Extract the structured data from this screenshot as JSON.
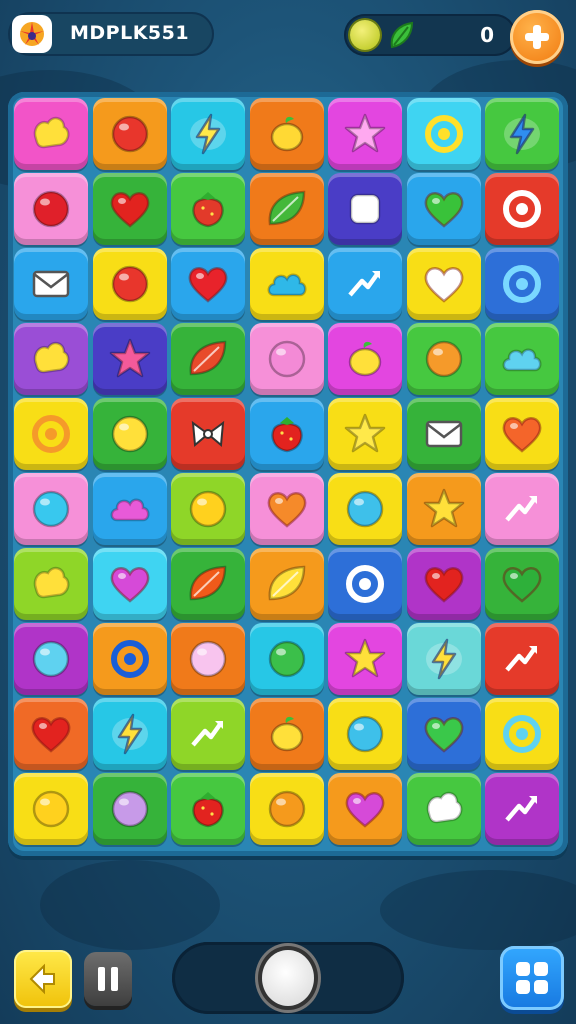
{
  "app": {
    "title": "MDPLK551"
  },
  "topbar": {
    "score": "0",
    "coin_icon": "coin-icon",
    "leaf_icon": "leaf-icon",
    "add_icon": "plus-icon"
  },
  "colors": {
    "pink": "#f254c8",
    "orange": "#f59a1c",
    "cyan": "#27c7e6",
    "darkorange": "#f07a1a",
    "magenta": "#e346e0",
    "sky": "#3fd4f2",
    "green": "#46c840",
    "lightpink": "#f690d8",
    "darkgreen": "#36b33a",
    "blue": "#2aa6ec",
    "navy": "#4a3dc6",
    "red": "#e53a2a",
    "yellow": "#f8de16",
    "purple": "#9a4ed6",
    "darkblue": "#2d6fd8",
    "orangered": "#f06a26",
    "lime": "#8fd628",
    "teal": "#3ed6d2",
    "violet": "#b034c8",
    "mint": "#6ad8d8"
  },
  "board": {
    "rows": [
      [
        {
          "c": "pink",
          "i": "blob",
          "f": "#ffe03a"
        },
        {
          "c": "orange",
          "i": "circle",
          "f": "#e8362c"
        },
        {
          "c": "cyan",
          "i": "bolt",
          "f": "#ffe94a"
        },
        {
          "c": "darkorange",
          "i": "lemon",
          "f": "#ffd934"
        },
        {
          "c": "magenta",
          "i": "star",
          "f": "#ffa9f0"
        },
        {
          "c": "sky",
          "i": "ring",
          "f": "#ffe02a"
        },
        {
          "c": "green",
          "i": "bolt",
          "f": "#2f8ef0"
        }
      ],
      [
        {
          "c": "lightpink",
          "i": "circle",
          "f": "#e0202a"
        },
        {
          "c": "darkgreen",
          "i": "heart",
          "f": "#e2231f"
        },
        {
          "c": "green",
          "i": "berry",
          "f": "#e23a2a"
        },
        {
          "c": "darkorange",
          "i": "leaf",
          "f": "#43b83a"
        },
        {
          "c": "navy",
          "i": "square",
          "f": "#ffffff"
        },
        {
          "c": "blue",
          "i": "heart",
          "f": "#39c23a"
        },
        {
          "c": "red",
          "i": "ring",
          "f": "#ffffff"
        }
      ],
      [
        {
          "c": "blue",
          "i": "envelope",
          "f": "#ffffff"
        },
        {
          "c": "yellow",
          "i": "circle",
          "f": "#e8362c"
        },
        {
          "c": "blue",
          "i": "heart",
          "f": "#e8232b"
        },
        {
          "c": "yellow",
          "i": "cloud",
          "f": "#2fb8e8"
        },
        {
          "c": "blue",
          "i": "arrow",
          "f": "#ffffff"
        },
        {
          "c": "yellow",
          "i": "heart",
          "f": "#ffffff"
        },
        {
          "c": "darkblue",
          "i": "ring",
          "f": "#7ad8ff"
        }
      ],
      [
        {
          "c": "purple",
          "i": "blob",
          "f": "#ffe03a"
        },
        {
          "c": "navy",
          "i": "star",
          "f": "#f45a9a"
        },
        {
          "c": "darkgreen",
          "i": "leaf",
          "f": "#e84a2a"
        },
        {
          "c": "lightpink",
          "i": "circle",
          "f": "#f38ad6"
        },
        {
          "c": "magenta",
          "i": "lemon",
          "f": "#ffe03a"
        },
        {
          "c": "green",
          "i": "circle",
          "f": "#f59a2a"
        },
        {
          "c": "green",
          "i": "cloud",
          "f": "#5fd2f0"
        }
      ],
      [
        {
          "c": "yellow",
          "i": "ring",
          "f": "#f59a2a"
        },
        {
          "c": "darkgreen",
          "i": "circle",
          "f": "#ffe03a"
        },
        {
          "c": "red",
          "i": "bow",
          "f": "#ffffff"
        },
        {
          "c": "blue",
          "i": "berry",
          "f": "#e2231f"
        },
        {
          "c": "yellow",
          "i": "star",
          "f": "#ffe94a"
        },
        {
          "c": "darkgreen",
          "i": "envelope",
          "f": "#ffffff"
        },
        {
          "c": "yellow",
          "i": "heart",
          "f": "#f4652a"
        }
      ],
      [
        {
          "c": "lightpink",
          "i": "circle",
          "f": "#38c8ee"
        },
        {
          "c": "blue",
          "i": "cloud",
          "f": "#e85ad8"
        },
        {
          "c": "lime",
          "i": "circle",
          "f": "#ffd11e"
        },
        {
          "c": "lightpink",
          "i": "heart",
          "f": "#f58a2a"
        },
        {
          "c": "yellow",
          "i": "circle",
          "f": "#3ec0ea"
        },
        {
          "c": "orange",
          "i": "star",
          "f": "#ffe03a"
        },
        {
          "c": "lightpink",
          "i": "arrow",
          "f": "#ffffff"
        }
      ],
      [
        {
          "c": "lime",
          "i": "blob",
          "f": "#ffe03a"
        },
        {
          "c": "sky",
          "i": "heart",
          "f": "#d64ad8"
        },
        {
          "c": "darkgreen",
          "i": "leaf",
          "f": "#f05a1a"
        },
        {
          "c": "orange",
          "i": "leaf",
          "f": "#ffe03a"
        },
        {
          "c": "darkblue",
          "i": "ring",
          "f": "#ffffff"
        },
        {
          "c": "violet",
          "i": "heart",
          "f": "#e2231f"
        },
        {
          "c": "darkgreen",
          "i": "heart",
          "f": "#2eb03a"
        }
      ],
      [
        {
          "c": "violet",
          "i": "circle",
          "f": "#5fd2f0"
        },
        {
          "c": "orange",
          "i": "ring",
          "f": "#1a5ed8"
        },
        {
          "c": "darkorange",
          "i": "circle",
          "f": "#f8c4ee"
        },
        {
          "c": "cyan",
          "i": "circle",
          "f": "#3bbf4a"
        },
        {
          "c": "magenta",
          "i": "star",
          "f": "#ffe03a"
        },
        {
          "c": "mint",
          "i": "bolt",
          "f": "#ffe03a"
        },
        {
          "c": "red",
          "i": "arrow",
          "f": "#ffffff"
        }
      ],
      [
        {
          "c": "orangered",
          "i": "heart",
          "f": "#e2231f"
        },
        {
          "c": "cyan",
          "i": "bolt",
          "f": "#ffe03a"
        },
        {
          "c": "lime",
          "i": "arrow",
          "f": "#ffffff"
        },
        {
          "c": "darkorange",
          "i": "lemon",
          "f": "#ffe03a"
        },
        {
          "c": "yellow",
          "i": "circle",
          "f": "#3ec0ea"
        },
        {
          "c": "darkblue",
          "i": "heart",
          "f": "#3ac84a"
        },
        {
          "c": "yellow",
          "i": "ring",
          "f": "#5fd2f0"
        }
      ],
      [
        {
          "c": "yellow",
          "i": "circle",
          "f": "#ffd11e"
        },
        {
          "c": "darkgreen",
          "i": "circle",
          "f": "#c79ae8"
        },
        {
          "c": "green",
          "i": "berry",
          "f": "#e2231f"
        },
        {
          "c": "yellow",
          "i": "circle",
          "f": "#f59a1c"
        },
        {
          "c": "orange",
          "i": "heart",
          "f": "#d64ad8"
        },
        {
          "c": "green",
          "i": "blob",
          "f": "#ffffff"
        },
        {
          "c": "violet",
          "i": "arrow",
          "f": "#ffffff"
        }
      ]
    ]
  },
  "bottombar": {
    "back_icon": "back-arrow-icon",
    "pause_icon": "pause-icon",
    "egg_icon": "egg-icon",
    "menu_icon": "grid-menu-icon"
  }
}
